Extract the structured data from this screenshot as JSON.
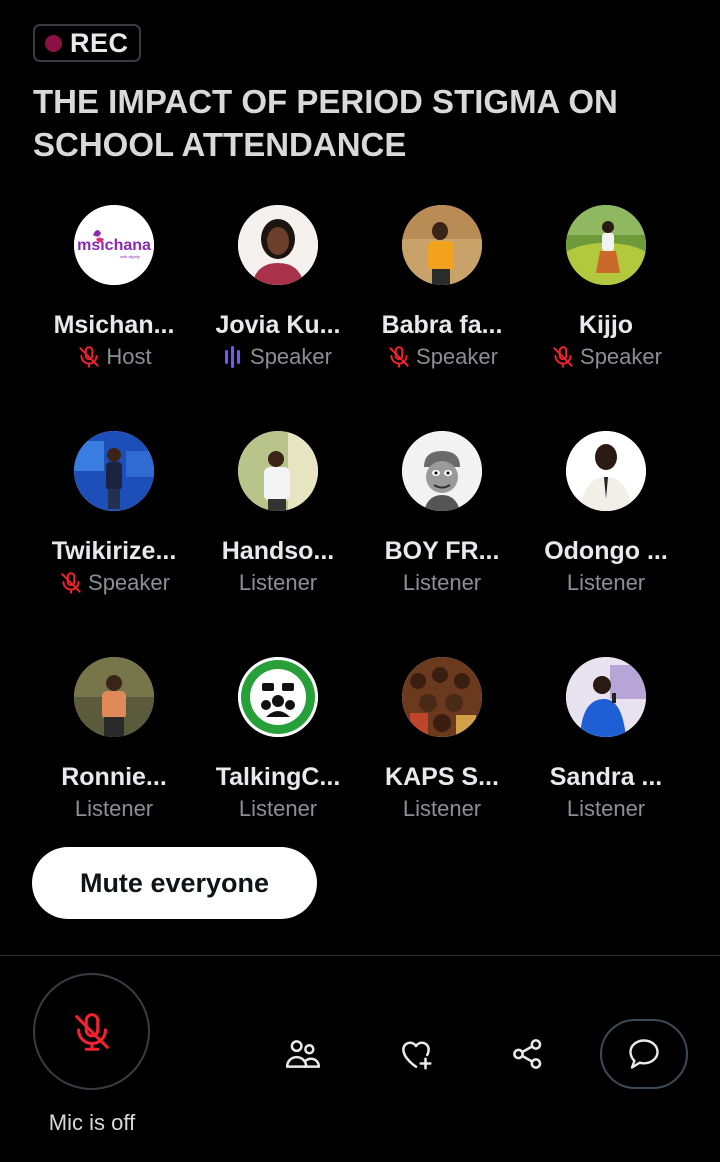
{
  "rec": {
    "label": "REC",
    "dot_color": "#8b1044"
  },
  "space": {
    "title": "THE IMPACT OF PERIOD STIGMA ON SCHOOL ATTENDANCE"
  },
  "participants": [
    {
      "name": "Msichan...",
      "role": "Host",
      "mic": "muted",
      "avatar_text": "msichana",
      "avatar_subtext": "with dignity"
    },
    {
      "name": "Jovia Ku...",
      "role": "Speaker",
      "mic": "speaking"
    },
    {
      "name": "Babra fa...",
      "role": "Speaker",
      "mic": "muted"
    },
    {
      "name": "Kijjo",
      "role": "Speaker",
      "mic": "muted"
    },
    {
      "name": "Twikirize...",
      "role": "Speaker",
      "mic": "muted"
    },
    {
      "name": "Handso...",
      "role": "Listener",
      "mic": "none"
    },
    {
      "name": "BOY FR...",
      "role": "Listener",
      "mic": "none"
    },
    {
      "name": "Odongo ...",
      "role": "Listener",
      "mic": "none"
    },
    {
      "name": "Ronnie...",
      "role": "Listener",
      "mic": "none"
    },
    {
      "name": "TalkingC...",
      "role": "Listener",
      "mic": "none"
    },
    {
      "name": "KAPS S...",
      "role": "Listener",
      "mic": "none"
    },
    {
      "name": "Sandra ...",
      "role": "Listener",
      "mic": "none"
    }
  ],
  "mute_everyone": {
    "label": "Mute everyone"
  },
  "bottom_bar": {
    "mic_label": "Mic is off",
    "muted_color": "#f4212e",
    "speaking_color": "#7856ff",
    "icons": [
      "people-icon",
      "heart-plus-icon",
      "share-icon",
      "chat-icon"
    ]
  }
}
